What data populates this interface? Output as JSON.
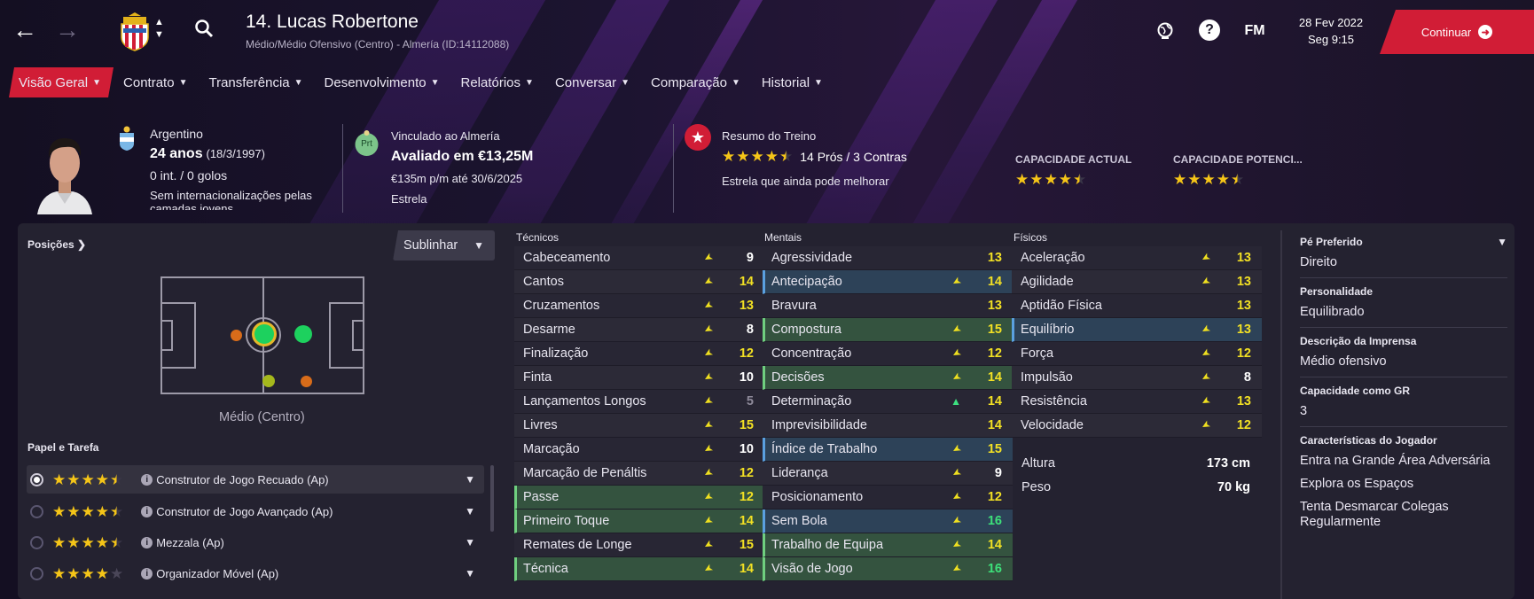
{
  "header": {
    "player_title": "14. Lucas Robertone",
    "player_subtitle": "Médio/Médio Ofensivo (Centro) - Almería (ID:14112088)",
    "date": "28 Fev 2022",
    "time": "Seg 9:15",
    "continue_label": "Continuar",
    "fm_label": "FM"
  },
  "tabs": [
    {
      "label": "Visão Geral",
      "active": true
    },
    {
      "label": "Contrato"
    },
    {
      "label": "Transferência"
    },
    {
      "label": "Desenvolvimento"
    },
    {
      "label": "Relatórios"
    },
    {
      "label": "Conversar"
    },
    {
      "label": "Comparação"
    },
    {
      "label": "Historial"
    }
  ],
  "profile": {
    "nationality": "Argentino",
    "age": "24 anos",
    "dob": "(18/3/1997)",
    "caps": "0 int. / 0 golos",
    "youth_caps": "Sem internacionalizações pelas camadas jovens",
    "contract_club": "Vinculado ao Almería",
    "badge_text": "Prt",
    "value": "Avaliado em €13,25M",
    "wage": "€135m p/m até 30/6/2025",
    "status": "Estrela",
    "training_title": "Resumo do Treino",
    "training_rating": 4.5,
    "pros_cons": "14 Prós / 3 Contras",
    "training_comment": "Estrela que ainda pode melhorar",
    "current_ability_label": "CAPACIDADE ACTUAL",
    "current_ability_stars": 4.5,
    "potential_ability_label": "CAPACIDADE POTENCI...",
    "potential_ability_stars": 4.5
  },
  "positions": {
    "header": "Posições",
    "highlight_select": "Sublinhar",
    "position_label": "Médio (Centro)"
  },
  "roles": {
    "header": "Papel e Tarefa",
    "items": [
      {
        "label": "Construtor de Jogo Recuado (Ap)",
        "stars": 4.5,
        "selected": true
      },
      {
        "label": "Construtor de Jogo Avançado (Ap)",
        "stars": 4.5
      },
      {
        "label": "Mezzala (Ap)",
        "stars": 4.5
      },
      {
        "label": "Organizador Móvel (Ap)",
        "stars": 4
      }
    ]
  },
  "attributes": {
    "technical": {
      "header": "Técnicos",
      "items": [
        {
          "name": "Cabeceamento",
          "value": 9,
          "trend": "down"
        },
        {
          "name": "Cantos",
          "value": 14,
          "trend": "down"
        },
        {
          "name": "Cruzamentos",
          "value": 13,
          "trend": "down"
        },
        {
          "name": "Desarme",
          "value": 8,
          "trend": "down"
        },
        {
          "name": "Finalização",
          "value": 12,
          "trend": "down"
        },
        {
          "name": "Finta",
          "value": 10,
          "trend": "down"
        },
        {
          "name": "Lançamentos Longos",
          "value": 5,
          "trend": "down"
        },
        {
          "name": "Livres",
          "value": 15,
          "trend": "down"
        },
        {
          "name": "Marcação",
          "value": 10,
          "trend": "down"
        },
        {
          "name": "Marcação de Penáltis",
          "value": 12,
          "trend": "down"
        },
        {
          "name": "Passe",
          "value": 12,
          "trend": "down",
          "hl": "g"
        },
        {
          "name": "Primeiro Toque",
          "value": 14,
          "trend": "down",
          "hl": "g"
        },
        {
          "name": "Remates de Longe",
          "value": 15,
          "trend": "down"
        },
        {
          "name": "Técnica",
          "value": 14,
          "trend": "down",
          "hl": "g"
        }
      ]
    },
    "mental": {
      "header": "Mentais",
      "items": [
        {
          "name": "Agressividade",
          "value": 13,
          "trend": "none"
        },
        {
          "name": "Antecipação",
          "value": 14,
          "trend": "down",
          "hl": "b"
        },
        {
          "name": "Bravura",
          "value": 13,
          "trend": "none"
        },
        {
          "name": "Compostura",
          "value": 15,
          "trend": "down",
          "hl": "g"
        },
        {
          "name": "Concentração",
          "value": 12,
          "trend": "down"
        },
        {
          "name": "Decisões",
          "value": 14,
          "trend": "down",
          "hl": "g"
        },
        {
          "name": "Determinação",
          "value": 14,
          "trend": "up"
        },
        {
          "name": "Imprevisibilidade",
          "value": 14,
          "trend": "none"
        },
        {
          "name": "Índice de Trabalho",
          "value": 15,
          "trend": "down",
          "hl": "b"
        },
        {
          "name": "Liderança",
          "value": 9,
          "trend": "down"
        },
        {
          "name": "Posicionamento",
          "value": 12,
          "trend": "down"
        },
        {
          "name": "Sem Bola",
          "value": 16,
          "trend": "down",
          "hl": "b"
        },
        {
          "name": "Trabalho de Equipa",
          "value": 14,
          "trend": "down",
          "hl": "g"
        },
        {
          "name": "Visão de Jogo",
          "value": 16,
          "trend": "down",
          "hl": "g"
        }
      ]
    },
    "physical": {
      "header": "Físicos",
      "items": [
        {
          "name": "Aceleração",
          "value": 13,
          "trend": "down"
        },
        {
          "name": "Agilidade",
          "value": 13,
          "trend": "down"
        },
        {
          "name": "Aptidão Física",
          "value": 13,
          "trend": "none"
        },
        {
          "name": "Equilíbrio",
          "value": 13,
          "trend": "down",
          "hl": "b"
        },
        {
          "name": "Força",
          "value": 12,
          "trend": "down"
        },
        {
          "name": "Impulsão",
          "value": 8,
          "trend": "down"
        },
        {
          "name": "Resistência",
          "value": 13,
          "trend": "down"
        },
        {
          "name": "Velocidade",
          "value": 12,
          "trend": "down"
        }
      ],
      "height_label": "Altura",
      "height": "173 cm",
      "weight_label": "Peso",
      "weight": "70 kg"
    }
  },
  "side": {
    "foot_label": "Pé Preferido",
    "foot": "Direito",
    "personality_label": "Personalidade",
    "personality": "Equilibrado",
    "press_label": "Descrição da Imprensa",
    "press": "Médio ofensivo",
    "gk_label": "Capacidade como GR",
    "gk": "3",
    "traits_label": "Características do Jogador",
    "traits": [
      "Entra na Grande Área Adversária",
      "Explora os Espaços",
      "Tenta Desmarcar Colegas Regularmente"
    ]
  },
  "colors": {
    "accent": "#d11d36",
    "value_yellow": "#f2e024",
    "value_green": "#3de07a",
    "highlight_green": "#34533f",
    "highlight_blue": "#2d4258"
  }
}
